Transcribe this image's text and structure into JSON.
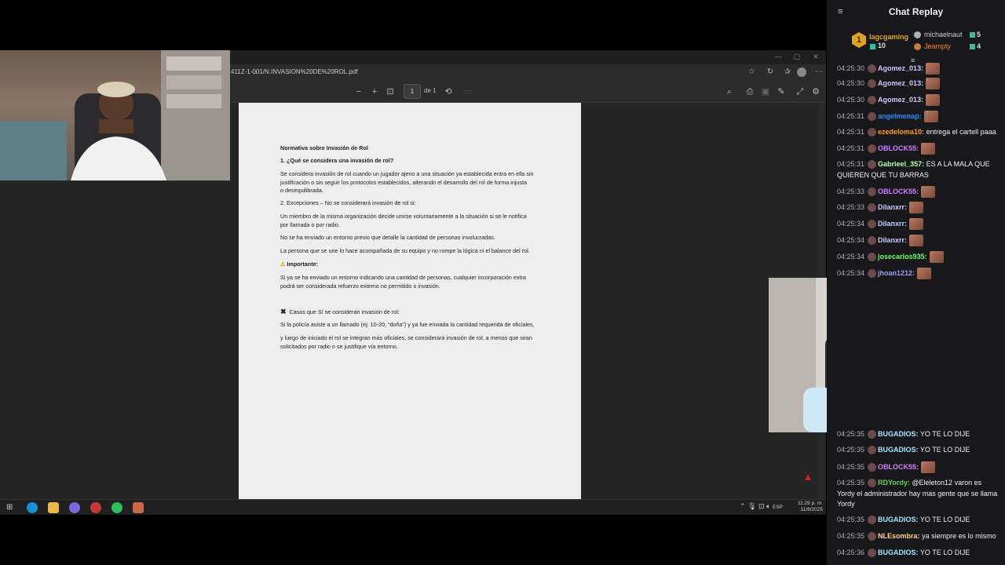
{
  "browser": {
    "url": "411Z-1-001/N.INVASION%20DE%20ROL.pdf"
  },
  "pdf_toolbar": {
    "page_number": "1",
    "page_of": "de 1"
  },
  "document": {
    "title": "Normativa sobre Invasión de Rol",
    "q1": "1. ¿Qué se considera una invasión de rol?",
    "p1_line1": " Se considera invasión de rol cuando un jugador ajeno a una situación ya establecida entra en ella sin",
    "p1_line2": "justificación o sin seguir los protocolos establecidos, alterando el desarrollo del rol de forma injusta",
    "p1_line3": "o desequilibrada.",
    "s2": "2. Excepciones – No se considerará invasión de rol si:",
    "e1_line1": "Un miembro de la misma organización decide unirse voluntariamente a la situación  si se le notifica",
    "e1_line2": "por llamada o por radio.",
    "e2": "No se ha enviado un entorno previo que detalle la cantidad de personas involucradas.",
    "e3": "La persona que se une lo hace acompañada de su equipo y no rompe la lógica ni el balance del rol.",
    "important_label": "Importante:",
    "imp_line1": " Si ya se ha enviado un entorno indicando una cantidad de personas, cualquier incorporación extra",
    "imp_line2": "podrá ser considerada refuerzo externo no permitido o invasión.",
    "cases_label": "Casos que Sí se consideran invasión de rol:",
    "c1": "Si la policía asiste a un llamado (ej: 10-20, “doña”) y ya fue enviada la cantidad requerida de oficiales,",
    "c2_line1": " y luego de iniciado el rol se integran más oficiales, se considerará invasión de rol, a menos que sean",
    "c2_line2": "solicitados por radio o se justifique vía entorno."
  },
  "taskbar": {
    "language": "ESP",
    "time": "11:29 p. m.",
    "date": "11/8/2025"
  },
  "chat": {
    "title": "Chat Replay",
    "leaderboard": [
      {
        "rank": "1",
        "name": "lagcgaming",
        "count": "10"
      },
      {
        "rank": "2",
        "name": "michaelnaut",
        "count": "5"
      },
      {
        "rank": "3",
        "name": "Jeampty",
        "count": "4"
      }
    ],
    "messages_top": [
      {
        "time": "04:25:30",
        "user": "Agomez_013:",
        "color": "#c9c9ff",
        "text": "",
        "emote": true
      },
      {
        "time": "04:25:30",
        "user": "Agomez_013:",
        "color": "#c9c9ff",
        "text": "",
        "emote": true
      },
      {
        "time": "04:25:30",
        "user": "Agomez_013:",
        "color": "#c9c9ff",
        "text": "",
        "emote": true
      },
      {
        "time": "04:25:31",
        "user": "angelmenap:",
        "color": "#1e90ff",
        "text": "",
        "emote": true
      },
      {
        "time": "04:25:31",
        "user": "ezedeloma10:",
        "color": "#ff9f1a",
        "text": "entrega el cartell paaa",
        "emote": false
      },
      {
        "time": "04:25:31",
        "user": "OBLOCK55:",
        "color": "#d77cff",
        "text": "",
        "emote": true
      },
      {
        "time": "04:25:31",
        "user": "Gabrieel_357:",
        "color": "#b3ffb3",
        "text": "ES A LA MALA QUE QUIEREN QUE TU BARRAS",
        "emote": false
      },
      {
        "time": "04:25:33",
        "user": "OBLOCK55:",
        "color": "#d77cff",
        "text": "",
        "emote": true
      },
      {
        "time": "04:25:33",
        "user": "Dilanxrr:",
        "color": "#c9c9ff",
        "text": "",
        "emote": true
      },
      {
        "time": "04:25:34",
        "user": "Dilanxrr:",
        "color": "#c9c9ff",
        "text": "",
        "emote": true
      },
      {
        "time": "04:25:34",
        "user": "Dilanxrr:",
        "color": "#c9c9ff",
        "text": "",
        "emote": true
      },
      {
        "time": "04:25:34",
        "user": "josecarlos935:",
        "color": "#66ff66",
        "text": "",
        "emote": true
      },
      {
        "time": "04:25:34",
        "user": "jhoan1212:",
        "color": "#9a9aff",
        "text": "",
        "emote": true
      }
    ],
    "messages_bottom": [
      {
        "time": "04:25:35",
        "user": "BUGADIOS:",
        "color": "#9fe6ff",
        "text": "YO TE LO DIJE"
      },
      {
        "time": "04:25:35",
        "user": "BUGADIOS:",
        "color": "#9fe6ff",
        "text": "YO TE LO DIJE"
      },
      {
        "time": "04:25:35",
        "user": "OBLOCK55:",
        "color": "#d77cff",
        "text": ""
      },
      {
        "time": "04:25:35",
        "user": "RDYordy:",
        "color": "#5fd35f",
        "text": "@Eleleton12 varon es Yordy el administrador hay mas gente que se llama Yordy"
      },
      {
        "time": "04:25:35",
        "user": "BUGADIOS:",
        "color": "#9fe6ff",
        "text": "YO TE LO DIJE"
      },
      {
        "time": "04:25:35",
        "user": "NLEsombra:",
        "color": "#ffd27f",
        "text": "ya siempre es lo mismo"
      },
      {
        "time": "04:25:36",
        "user": "BUGADIOS:",
        "color": "#9fe6ff",
        "text": "YO TE LO DIJE"
      }
    ]
  }
}
